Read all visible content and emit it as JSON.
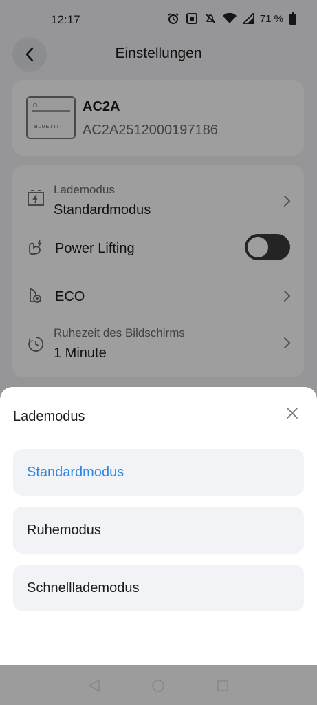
{
  "status_bar": {
    "time": "12:17",
    "battery": "71 %"
  },
  "header": {
    "title": "Einstellungen"
  },
  "device": {
    "name": "AC2A",
    "serial": "AC2A2512000197186",
    "brand_mark": "BLUETTI"
  },
  "settings": {
    "charge_mode_label": "Lademodus",
    "charge_mode_value": "Standardmodus",
    "power_lifting_label": "Power Lifting",
    "power_lifting_on": false,
    "eco_label": "ECO",
    "screen_timeout_label": "Ruhezeit des Bildschirms",
    "screen_timeout_value": "1 Minute"
  },
  "sheet": {
    "title": "Lademodus",
    "options": [
      {
        "label": "Standardmodus",
        "selected": true
      },
      {
        "label": "Ruhemodus",
        "selected": false
      },
      {
        "label": "Schnelllademodus",
        "selected": false
      }
    ]
  },
  "colors": {
    "accent": "#2f86e0",
    "toggle_off": "#3a3a3a"
  },
  "icons": {
    "back": "back-arrow-icon",
    "close": "close-icon",
    "chevron": "chevron-right-icon"
  }
}
